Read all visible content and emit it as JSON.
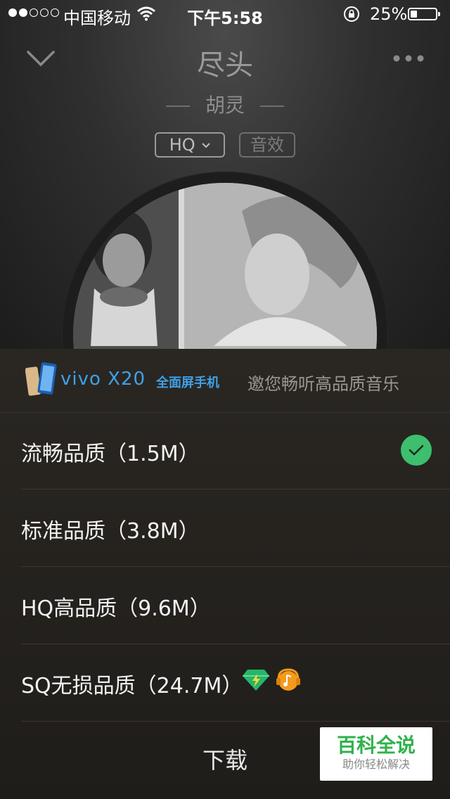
{
  "status_bar": {
    "carrier": "中国移动",
    "time": "下午5:58",
    "battery_percent": "25%",
    "battery_level": 0.25,
    "signal_bars_filled": 2
  },
  "player": {
    "song_title": "尽头",
    "artist": "胡灵",
    "quality_button": "HQ",
    "effect_button": "音效"
  },
  "sheet": {
    "ad": {
      "brand": "vivo X20",
      "brand_sub": "全面屏手机",
      "slogan": "邀您畅听高品质音乐"
    },
    "options": [
      {
        "label": "流畅品质（1.5M）",
        "selected": true
      },
      {
        "label": "标准品质（3.8M）",
        "selected": false
      },
      {
        "label": "HQ高品质（9.6M）",
        "selected": false
      },
      {
        "label": "SQ无损品质（24.7M）",
        "selected": false
      }
    ],
    "download_label": "下载"
  },
  "watermark": {
    "title": "百科全说",
    "subtitle": "助你轻松解决"
  },
  "colors": {
    "accent_green": "#3dbf6e",
    "ad_blue": "#3fa1e8"
  }
}
